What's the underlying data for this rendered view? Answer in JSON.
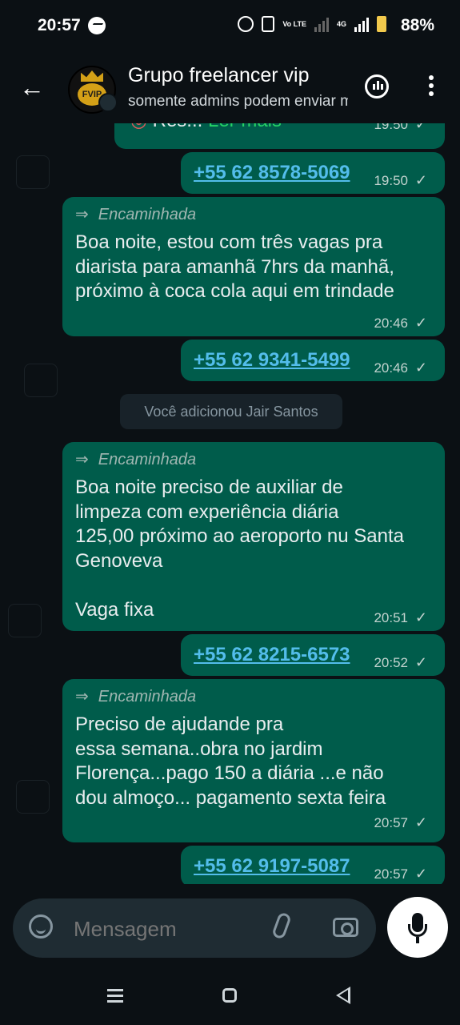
{
  "status_bar": {
    "time": "20:57",
    "network_label": "Vo LTE",
    "network_4g": "4G",
    "battery": "88%"
  },
  "header": {
    "back_icon": "arrow-left-icon",
    "avatar_text": "FVIP",
    "title": "Grupo freelancer vip",
    "subtitle": "somente admins podem enviar mensagens",
    "voice_chat_icon": "audio-chat-icon",
    "menu_icon": "more-vert-icon"
  },
  "messages": [
    {
      "id": "m0",
      "type": "truncated",
      "text": "Res... ",
      "read_more": "Ler mais",
      "time": "19:50"
    },
    {
      "id": "m1",
      "type": "phone",
      "text": "+55 62 8578-5069",
      "time": "19:50"
    },
    {
      "id": "m2",
      "type": "forwarded",
      "forward_label": "Encaminhada",
      "text": "Boa noite, estou com três vagas pra diarista para amanhã 7hrs da manhã, próximo à coca cola aqui em trindade",
      "time": "20:46"
    },
    {
      "id": "m3",
      "type": "phone",
      "text": "+55 62 9341-5499",
      "time": "20:46"
    },
    {
      "id": "sys",
      "type": "system",
      "text": "Você adicionou Jair Santos"
    },
    {
      "id": "m4",
      "type": "forwarded",
      "forward_label": "Encaminhada",
      "text_lines": [
        "Boa noite preciso de auxiliar de",
        "limpeza com experiência diária",
        "125,00 próximo ao aeroporto nu Santa",
        "Genoveva",
        "",
        "Vaga fixa"
      ],
      "time": "20:51"
    },
    {
      "id": "m5",
      "type": "phone",
      "text": "+55 62 8215-6573",
      "time": "20:52"
    },
    {
      "id": "m6",
      "type": "forwarded",
      "forward_label": "Encaminhada",
      "text_lines": [
        "Preciso de ajudande pra",
        "essa semana..obra no jardim",
        "Florença...pago 150 a diária ...e não",
        "dou almoço... pagamento sexta feira"
      ],
      "time": "20:57"
    },
    {
      "id": "m7",
      "type": "phone",
      "text": "+55 62 9197-5087",
      "time": "20:57"
    }
  ],
  "composer": {
    "placeholder": "Mensagem",
    "emoji_icon": "sticker-icon",
    "attach_icon": "paperclip-icon",
    "camera_icon": "camera-icon",
    "mic_icon": "microphone-icon"
  },
  "colors": {
    "bubble_out": "#005c4b",
    "background": "#0b1014",
    "link": "#53bdeb"
  }
}
